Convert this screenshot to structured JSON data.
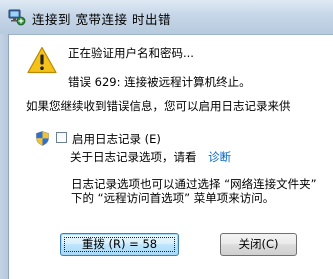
{
  "titlebar": {
    "title": "连接到 宽带连接 时出错",
    "icon": "network-connection-icon"
  },
  "content": {
    "status_line": "正在验证用户名和密码...",
    "error_line": "错误 629: 连接被远程计算机终止。",
    "info_line": "如果您继续收到错误信息，您可以启用日志记录来供",
    "logging_checkbox_label": "启用日志记录 (E)",
    "logging_checked": false,
    "about_logging": "关于日志记录选项，请看",
    "diagnose_link": "诊断",
    "note_line1": "日志记录选项也可以通过选择 “网络连接文件夹”",
    "note_line2": "下的 “远程访问首选项” 菜单项来访问。"
  },
  "buttons": {
    "redial_label": "重拨 (R) = 58",
    "close_label": "关闭(C)"
  },
  "icons": {
    "warning": "warning-icon",
    "shield": "uac-shield-icon"
  },
  "colors": {
    "link": "#0066cc",
    "warning_yellow": "#f5c21b",
    "titlebar": "#c6d6e8"
  }
}
